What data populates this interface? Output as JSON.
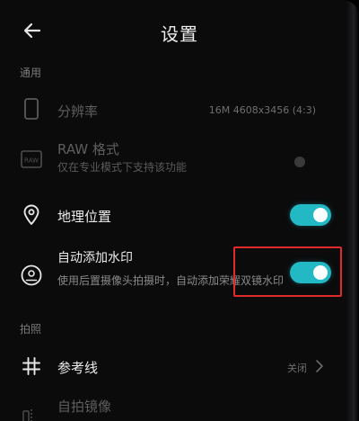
{
  "header": {
    "title": "设置",
    "back_icon": "back-arrow-icon"
  },
  "sections": {
    "general": "通用",
    "shooting": "拍照"
  },
  "rows": {
    "resolution": {
      "icon": "phone-outline-icon",
      "title": "分辨率",
      "value": "16M 4608x3456 (4:3)"
    },
    "raw_format": {
      "icon": "raw-icon",
      "icon_text": "RAW",
      "title": "RAW 格式",
      "subtitle": "仅在专业模式下支持该功能",
      "toggle": "disabled-off"
    },
    "location": {
      "icon": "location-pin-icon",
      "title": "地理位置",
      "toggle": "on"
    },
    "watermark": {
      "icon": "portrait-badge-icon",
      "title": "自动添加水印",
      "subtitle": "使用后置摄像头拍摄时，自动添加荣耀双镜水印",
      "toggle": "on"
    },
    "grid": {
      "icon": "grid-hash-icon",
      "title": "参考线",
      "value": "关闭"
    },
    "selfie_mirror": {
      "title": "自拍镜像"
    }
  },
  "colors": {
    "background": "#0b0b0c",
    "toggle_on": "#22b8c4",
    "highlight": "#e22a2a"
  }
}
